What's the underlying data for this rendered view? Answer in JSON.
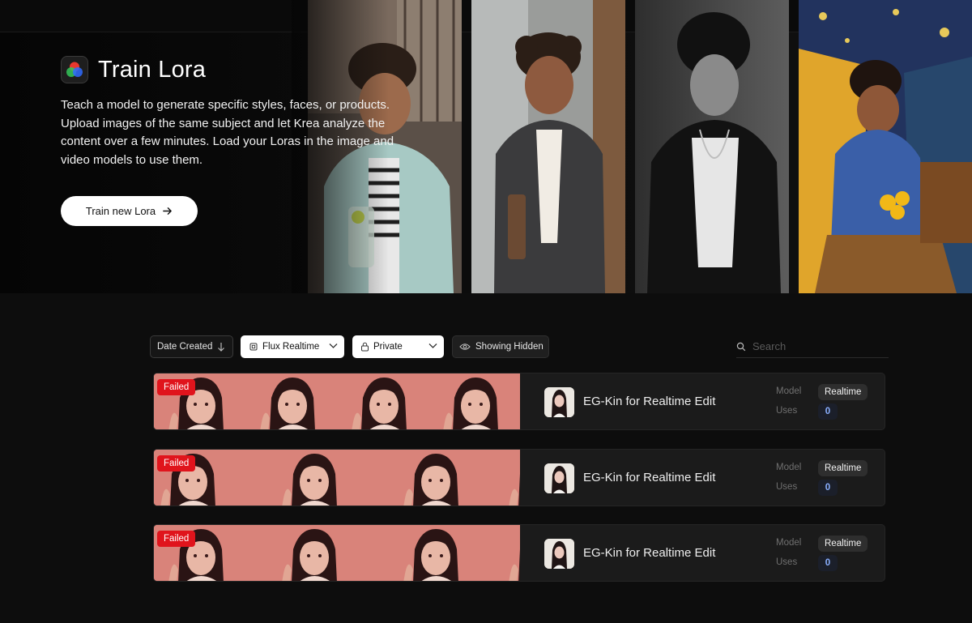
{
  "hero": {
    "title": "Train Lora",
    "description": "Teach a model to generate specific styles, faces, or products. Upload images of the same subject and let Krea analyze the content over a few minutes. Load your Loras in the image and video models to use them.",
    "cta_label": "Train new Lora",
    "app_icon": "color-wheel-icon"
  },
  "filters": {
    "sort_label": "Date Created",
    "model_label": "Flux Realtime",
    "privacy_label": "Private",
    "hidden_label": "Showing Hidden",
    "search_placeholder": "Search"
  },
  "loras": [
    {
      "status": "Failed",
      "name": "EG-Kin for Realtime Edit",
      "model_label": "Model",
      "model_value": "Realtime",
      "uses_label": "Uses",
      "uses_value": "0"
    },
    {
      "status": "Failed",
      "name": "EG-Kin for Realtime Edit",
      "model_label": "Model",
      "model_value": "Realtime",
      "uses_label": "Uses",
      "uses_value": "0"
    },
    {
      "status": "Failed",
      "name": "EG-Kin for Realtime Edit",
      "model_label": "Model",
      "model_value": "Realtime",
      "uses_label": "Uses",
      "uses_value": "0"
    }
  ],
  "colors": {
    "background": "#0d0d0d",
    "card": "#1b1b1b",
    "failed": "#e0141c",
    "uses_accent": "#8ab0ff",
    "thumb_tint": "#d9837a"
  }
}
